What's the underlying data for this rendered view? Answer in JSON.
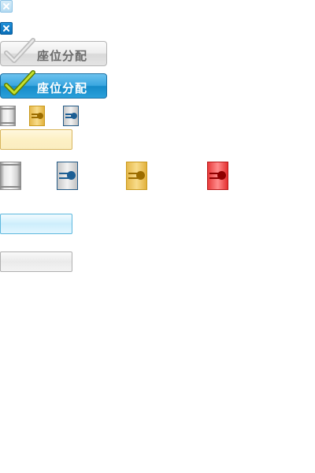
{
  "close_buttons": [
    {
      "variant": "light",
      "icon": "close-icon",
      "glyph_color": "#ffffff"
    },
    {
      "variant": "dark",
      "icon": "close-icon",
      "glyph_color": "#ffffff"
    }
  ],
  "seat_allocation_buttons": [
    {
      "label": "座位分配",
      "variant": "gray",
      "check_color": "#c9c9c9"
    },
    {
      "label": "座位分配",
      "variant": "blue",
      "check_color": "#c6e22e"
    }
  ],
  "seat_colors": {
    "plain": "#d0d0d0",
    "gold": "#e3b535",
    "blue": "#1d5f94",
    "red": "#e32626"
  },
  "fields": [
    {
      "variant": "gold",
      "value": ""
    },
    {
      "variant": "blue",
      "value": ""
    },
    {
      "variant": "gray",
      "value": ""
    }
  ]
}
